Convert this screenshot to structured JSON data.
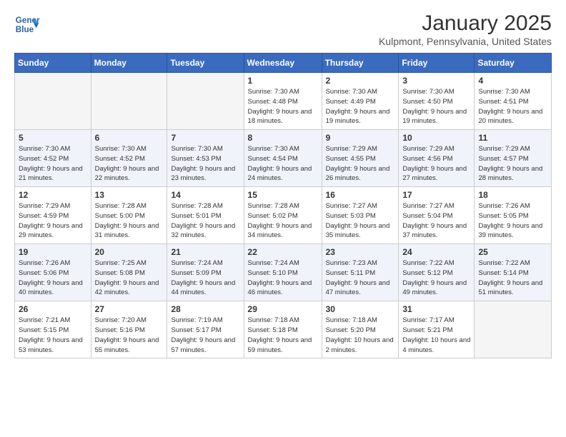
{
  "header": {
    "logo_line1": "General",
    "logo_line2": "Blue",
    "month": "January 2025",
    "location": "Kulpmont, Pennsylvania, United States"
  },
  "weekdays": [
    "Sunday",
    "Monday",
    "Tuesday",
    "Wednesday",
    "Thursday",
    "Friday",
    "Saturday"
  ],
  "weeks": [
    [
      {
        "day": "",
        "empty": true
      },
      {
        "day": "",
        "empty": true
      },
      {
        "day": "",
        "empty": true
      },
      {
        "day": "1",
        "sunrise": "7:30 AM",
        "sunset": "4:48 PM",
        "daylight": "9 hours and 18 minutes."
      },
      {
        "day": "2",
        "sunrise": "7:30 AM",
        "sunset": "4:49 PM",
        "daylight": "9 hours and 19 minutes."
      },
      {
        "day": "3",
        "sunrise": "7:30 AM",
        "sunset": "4:50 PM",
        "daylight": "9 hours and 19 minutes."
      },
      {
        "day": "4",
        "sunrise": "7:30 AM",
        "sunset": "4:51 PM",
        "daylight": "9 hours and 20 minutes."
      }
    ],
    [
      {
        "day": "5",
        "sunrise": "7:30 AM",
        "sunset": "4:52 PM",
        "daylight": "9 hours and 21 minutes."
      },
      {
        "day": "6",
        "sunrise": "7:30 AM",
        "sunset": "4:52 PM",
        "daylight": "9 hours and 22 minutes."
      },
      {
        "day": "7",
        "sunrise": "7:30 AM",
        "sunset": "4:53 PM",
        "daylight": "9 hours and 23 minutes."
      },
      {
        "day": "8",
        "sunrise": "7:30 AM",
        "sunset": "4:54 PM",
        "daylight": "9 hours and 24 minutes."
      },
      {
        "day": "9",
        "sunrise": "7:29 AM",
        "sunset": "4:55 PM",
        "daylight": "9 hours and 26 minutes."
      },
      {
        "day": "10",
        "sunrise": "7:29 AM",
        "sunset": "4:56 PM",
        "daylight": "9 hours and 27 minutes."
      },
      {
        "day": "11",
        "sunrise": "7:29 AM",
        "sunset": "4:57 PM",
        "daylight": "9 hours and 28 minutes."
      }
    ],
    [
      {
        "day": "12",
        "sunrise": "7:29 AM",
        "sunset": "4:59 PM",
        "daylight": "9 hours and 29 minutes."
      },
      {
        "day": "13",
        "sunrise": "7:28 AM",
        "sunset": "5:00 PM",
        "daylight": "9 hours and 31 minutes."
      },
      {
        "day": "14",
        "sunrise": "7:28 AM",
        "sunset": "5:01 PM",
        "daylight": "9 hours and 32 minutes."
      },
      {
        "day": "15",
        "sunrise": "7:28 AM",
        "sunset": "5:02 PM",
        "daylight": "9 hours and 34 minutes."
      },
      {
        "day": "16",
        "sunrise": "7:27 AM",
        "sunset": "5:03 PM",
        "daylight": "9 hours and 35 minutes."
      },
      {
        "day": "17",
        "sunrise": "7:27 AM",
        "sunset": "5:04 PM",
        "daylight": "9 hours and 37 minutes."
      },
      {
        "day": "18",
        "sunrise": "7:26 AM",
        "sunset": "5:05 PM",
        "daylight": "9 hours and 39 minutes."
      }
    ],
    [
      {
        "day": "19",
        "sunrise": "7:26 AM",
        "sunset": "5:06 PM",
        "daylight": "9 hours and 40 minutes."
      },
      {
        "day": "20",
        "sunrise": "7:25 AM",
        "sunset": "5:08 PM",
        "daylight": "9 hours and 42 minutes."
      },
      {
        "day": "21",
        "sunrise": "7:24 AM",
        "sunset": "5:09 PM",
        "daylight": "9 hours and 44 minutes."
      },
      {
        "day": "22",
        "sunrise": "7:24 AM",
        "sunset": "5:10 PM",
        "daylight": "9 hours and 46 minutes."
      },
      {
        "day": "23",
        "sunrise": "7:23 AM",
        "sunset": "5:11 PM",
        "daylight": "9 hours and 47 minutes."
      },
      {
        "day": "24",
        "sunrise": "7:22 AM",
        "sunset": "5:12 PM",
        "daylight": "9 hours and 49 minutes."
      },
      {
        "day": "25",
        "sunrise": "7:22 AM",
        "sunset": "5:14 PM",
        "daylight": "9 hours and 51 minutes."
      }
    ],
    [
      {
        "day": "26",
        "sunrise": "7:21 AM",
        "sunset": "5:15 PM",
        "daylight": "9 hours and 53 minutes."
      },
      {
        "day": "27",
        "sunrise": "7:20 AM",
        "sunset": "5:16 PM",
        "daylight": "9 hours and 55 minutes."
      },
      {
        "day": "28",
        "sunrise": "7:19 AM",
        "sunset": "5:17 PM",
        "daylight": "9 hours and 57 minutes."
      },
      {
        "day": "29",
        "sunrise": "7:18 AM",
        "sunset": "5:18 PM",
        "daylight": "9 hours and 59 minutes."
      },
      {
        "day": "30",
        "sunrise": "7:18 AM",
        "sunset": "5:20 PM",
        "daylight": "10 hours and 2 minutes."
      },
      {
        "day": "31",
        "sunrise": "7:17 AM",
        "sunset": "5:21 PM",
        "daylight": "10 hours and 4 minutes."
      },
      {
        "day": "",
        "empty": true
      }
    ]
  ]
}
